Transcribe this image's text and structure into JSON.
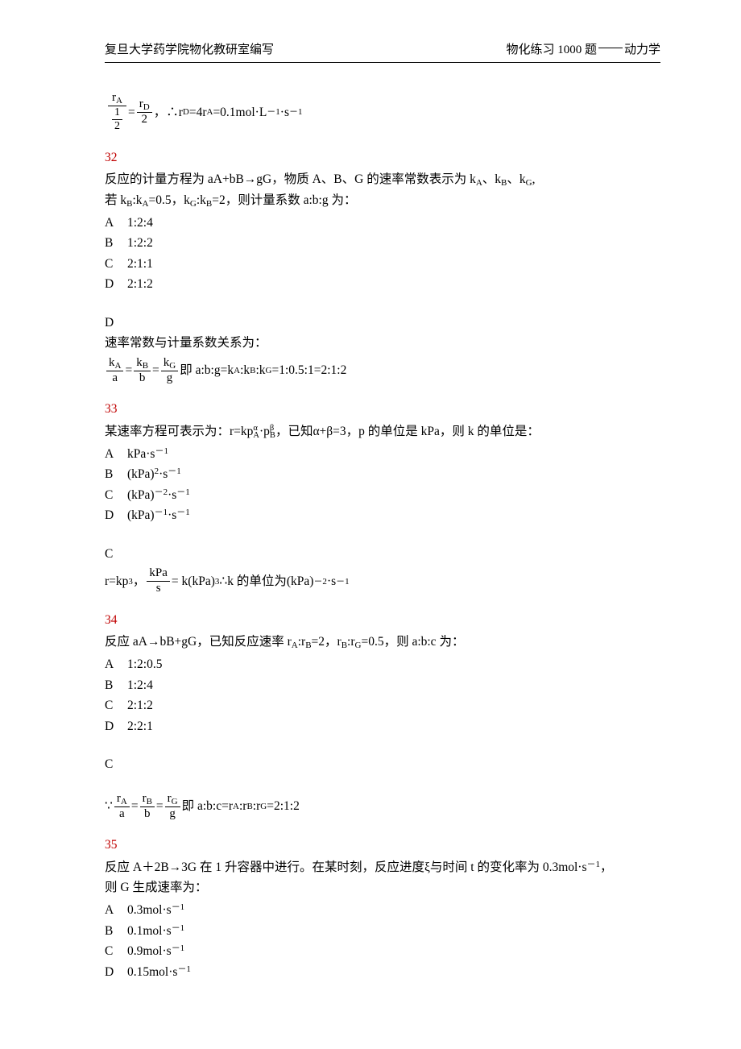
{
  "header": {
    "left": "复旦大学药学院物化教研室编写",
    "right_prefix": "物化练习 1000 题",
    "right_suffix": "动力学"
  },
  "top_soln": {
    "frac_left_num": "r",
    "frac_left_num_sub": "A",
    "frac_left_den_num": "1",
    "frac_left_den_den": "2",
    "eq1": " = ",
    "frac_right_num": "r",
    "frac_right_num_sub": "D",
    "frac_right_den": "2",
    "rest": "，∴r",
    "rest_sub": "D",
    "rest2": "=4r",
    "rest2_sub": "A",
    "rest3": "=0.1mol·L",
    "rest3_sup": "－1",
    "rest4": "·s",
    "rest4_sup": "－1"
  },
  "q32": {
    "num": "32",
    "stem1": "反应的计量方程为 aA+bB→gG，物质 A、B、G 的速率常数表示为 k",
    "stem1s1": "A",
    "stem1a": "、k",
    "stem1s2": "B",
    "stem1b": "、k",
    "stem1s3": "G",
    "stem1c": ",",
    "stem2a": "若 k",
    "stem2s1": "B",
    "stem2b": ":k",
    "stem2s2": "A",
    "stem2c": "=0.5，k",
    "stem2s3": "G",
    "stem2d": ":k",
    "stem2s4": "B",
    "stem2e": "=2，则计量系数 a:b:g 为：",
    "opts": {
      "A": "1:2:4",
      "B": "1:2:2",
      "C": "2:1:1",
      "D": "2:1:2"
    },
    "ans": "D",
    "sol1": "速率常数与计量系数关系为：",
    "sol_frac1n": "k",
    "sol_frac1ns": "A",
    "sol_frac1d": "a",
    "sol_frac2n": "k",
    "sol_frac2ns": "B",
    "sol_frac2d": "b",
    "sol_frac3n": "k",
    "sol_frac3ns": "G",
    "sol_frac3d": "g",
    "sol_rest": " 即 a:b:g=k",
    "sol_sA": "A",
    "sol_r2": ":k",
    "sol_sB": "B",
    "sol_r3": ":k",
    "sol_sG": "G",
    "sol_r4": "=1:0.5:1=2:1:2"
  },
  "q33": {
    "num": "33",
    "stem": "某速率方程可表示为：r=kp",
    "sA": "A",
    "sup_a": "α",
    "mid": "·p",
    "sB": "B",
    "sup_b": "β",
    "rest": "，已知α+β=3，p 的单位是 kPa，则 k 的单位是：",
    "opts": {
      "A": {
        "t": "kPa·s",
        "sup": "－1"
      },
      "B": {
        "t": "(kPa)",
        "sup1": "2",
        "mid": "·s",
        "sup2": "－1"
      },
      "C": {
        "t": "(kPa)",
        "sup1": "－2",
        "mid": "·s",
        "sup2": "－1"
      },
      "D": {
        "t": "(kPa)",
        "sup1": "－1",
        "mid": "·s",
        "sup2": "－1"
      }
    },
    "ans": "C",
    "sol_pre": "r=kp",
    "sol_sup": "3",
    "sol_comma": "，",
    "frac_n": "kPa",
    "frac_d": "s",
    "sol_eq": " = k(kPa)",
    "sol_eq_sup": "3",
    "sol_there": " ∴k 的单位为(kPa)",
    "sol_s1": "－2",
    "sol_mid": "·s",
    "sol_s2": "－1"
  },
  "q34": {
    "num": "34",
    "stem": "反应 aA→bB+gG，已知反应速率 r",
    "sA": "A",
    "c1": ":r",
    "sB": "B",
    "c2": "=2，r",
    "sB2": "B",
    "c3": ":r",
    "sG": "G",
    "c4": "=0.5，则 a:b:c 为：",
    "opts": {
      "A": "1:2:0.5",
      "B": "1:2:4",
      "C": "2:1:2",
      "D": "2:2:1"
    },
    "ans": "C",
    "sol_pre": "∵",
    "f1n": "r",
    "f1ns": "A",
    "f1d": "a",
    "f2n": "r",
    "f2ns": "B",
    "f2d": "b",
    "f3n": "r",
    "f3ns": "G",
    "f3d": "g",
    "sol_rest": " 即 a:b:c=r",
    "srA": "A",
    "r2": ":r",
    "srB": "B",
    "r3": ":r",
    "srG": "G",
    "r4": "=2:1:2"
  },
  "q35": {
    "num": "35",
    "stem": "反应 A＋2B→3G 在 1 升容器中进行。在某时刻，反应进度ξ与时间 t 的变化率为 0.3mol·s",
    "sup": "－1",
    "stem2": "，",
    "stem3": "则 G 生成速率为：",
    "opts": {
      "A": {
        "t": "0.3mol·s",
        "sup": "－1"
      },
      "B": {
        "t": "0.1mol·s",
        "sup": "－1"
      },
      "C": {
        "t": "0.9mol·s",
        "sup": "－1"
      },
      "D": {
        "t": "0.15mol·s",
        "sup": "－1"
      }
    }
  }
}
